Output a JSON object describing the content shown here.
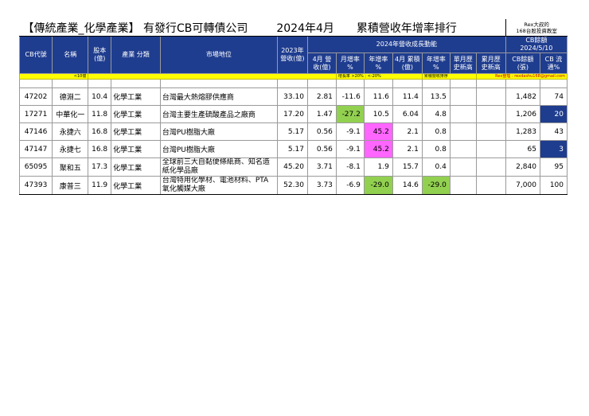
{
  "title": {
    "main": "【傳統產業_化學產業】 有發行CB可轉債公司",
    "date": "2024年4月",
    "subtitle": "累積營收年增率排行"
  },
  "credit": {
    "line1": "Rex大叔的",
    "line2": "168台股投資教室"
  },
  "headers": {
    "cb_code": "CB代號",
    "name": "名稱",
    "capital": "股本 (億)",
    "industry": "產業 分類",
    "market": "市場地位",
    "rev2023": "2023年 營收(億)",
    "growth_group": "2024年營收成長動能",
    "apr_rev": "4月 營收(億)",
    "mom": "月增率 %",
    "yoy": "年增率 %",
    "apr_cum": "4月 累積(億)",
    "cum_yoy": "年增率 %",
    "single_high": "單月歷 史新高",
    "cum_high": "累月歷 史新高",
    "cb_group_line1": "CB餘額",
    "cb_group_line2": "2024/5/10",
    "cb_balance": "CB餘額 (張)",
    "cb_float": "CB 流通%"
  },
  "legend": {
    "capital_note": "<10億",
    "growth_note": "增長率 >20% ; <-20%",
    "cum_note": "累積營收排序",
    "author": "Rex整理 : rexdashu168@gmail.com"
  },
  "rows": [
    {
      "code": "47202",
      "name": "德淵二",
      "capital": "10.4",
      "industry": "化學工業",
      "market": "台灣最大熱熔膠供應商",
      "rev2023": "33.10",
      "apr": "2.81",
      "mom": "-11.6",
      "yoy": "11.6",
      "cum": "11.4",
      "cum_yoy": "13.5",
      "single_high": "",
      "cum_high": "",
      "cb_balance": "1,482",
      "cb_float": "74"
    },
    {
      "code": "17271",
      "name": "中華化一",
      "capital": "11.8",
      "industry": "化學工業",
      "market": "台灣主要生產硫酸產品之廠商",
      "rev2023": "17.20",
      "apr": "1.47",
      "mom": "-27.2",
      "yoy": "10.5",
      "cum": "6.04",
      "cum_yoy": "4.8",
      "single_high": "",
      "cum_high": "",
      "cb_balance": "1,206",
      "cb_float": "20"
    },
    {
      "code": "47146",
      "name": "永捷六",
      "capital": "16.8",
      "industry": "化學工業",
      "market": "台灣PU樹脂大廠",
      "rev2023": "5.17",
      "apr": "0.56",
      "mom": "-9.1",
      "yoy": "45.2",
      "cum": "2.1",
      "cum_yoy": "0.8",
      "single_high": "",
      "cum_high": "",
      "cb_balance": "1,283",
      "cb_float": "43"
    },
    {
      "code": "47147",
      "name": "永捷七",
      "capital": "16.8",
      "industry": "化學工業",
      "market": "台灣PU樹脂大廠",
      "rev2023": "5.17",
      "apr": "0.56",
      "mom": "-9.1",
      "yoy": "45.2",
      "cum": "2.1",
      "cum_yoy": "0.8",
      "single_high": "",
      "cum_high": "",
      "cb_balance": "65",
      "cb_float": "3"
    },
    {
      "code": "65095",
      "name": "聚和五",
      "capital": "17.3",
      "industry": "化學工業",
      "market": "全球前三大自黏便條紙商、知名造紙化學品廠",
      "rev2023": "45.20",
      "apr": "3.71",
      "mom": "-8.1",
      "yoy": "1.9",
      "cum": "15.7",
      "cum_yoy": "0.4",
      "single_high": "",
      "cum_high": "",
      "cb_balance": "2,840",
      "cb_float": "95"
    },
    {
      "code": "47393",
      "name": "康普三",
      "capital": "11.9",
      "industry": "化學工業",
      "market": "台灣特用化學材、電池材料、PTA氧化觸媒大廠",
      "rev2023": "52.30",
      "apr": "3.73",
      "mom": "-6.9",
      "yoy": "-29.0",
      "cum": "14.6",
      "cum_yoy": "-29.0",
      "single_high": "",
      "cum_high": "",
      "cb_balance": "7,000",
      "cb_float": "100"
    }
  ],
  "colors": {
    "header_bg": "#1f3d8f",
    "highlight_green": "#92d050",
    "highlight_pink": "#ff66ff",
    "legend_bar": "#ffff00",
    "author_text": "#c00000"
  }
}
